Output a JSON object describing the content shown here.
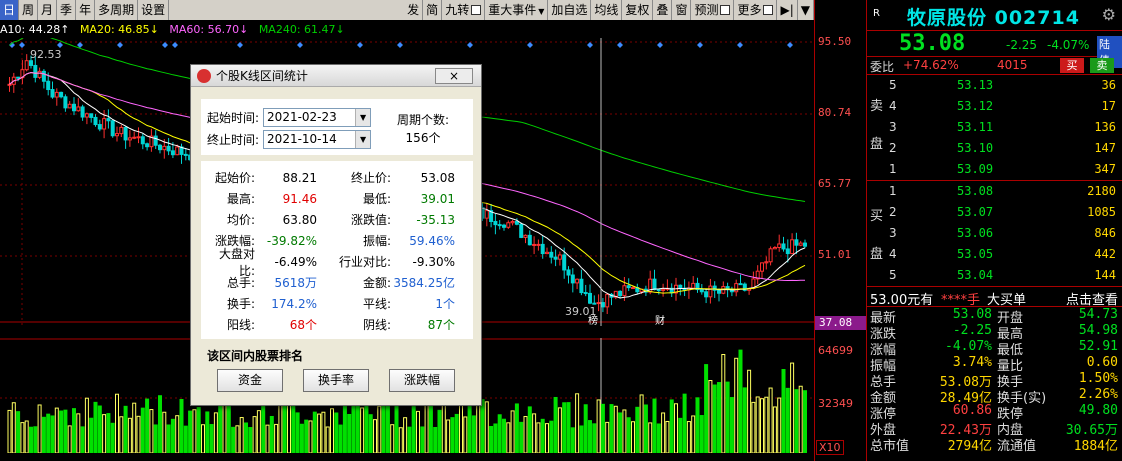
{
  "toolbar": {
    "left": [
      "日",
      "周",
      "月",
      "季",
      "年",
      "多周期",
      "设置"
    ],
    "right": [
      "发",
      "简",
      "九转",
      "重大事件",
      "加自选",
      "均线",
      "复权",
      "叠",
      "窗",
      "预测",
      "更多"
    ]
  },
  "ma": {
    "ma10": "A10: 44.28↑",
    "ma20": "MA20: 46.85↓",
    "ma60": "MA60: 56.70↓",
    "ma240": "MA240: 61.47↓",
    "colors": {
      "ma10": "#ffffff",
      "ma20": "#ffff00",
      "ma60": "#ff66ff",
      "ma240": "#00d000"
    }
  },
  "price_axis": [
    "95.50",
    "80.74",
    "65.77",
    "51.01",
    "37.08"
  ],
  "volume_axis": {
    "top": "64699",
    "mid": "32349",
    "unit": "X10"
  },
  "chart_marks": {
    "high_label": "92.53",
    "low_label": "39.01",
    "tag_1": "榜",
    "tag_2": "财"
  },
  "dialog": {
    "title": "个股K线区间统计",
    "close_label": "×",
    "start_label": "起始时间:",
    "start_value": "2021-02-23",
    "end_label": "终止时间:",
    "end_value": "2021-10-14",
    "period_label": "周期个数:",
    "period_value": "156个",
    "stats": [
      {
        "l1": "起始价:",
        "v1": "88.21",
        "c1": "",
        "l2": "终止价:",
        "v2": "53.08",
        "c2": ""
      },
      {
        "l1": "最高:",
        "v1": "91.46",
        "c1": "red",
        "l2": "最低:",
        "v2": "39.01",
        "c2": "green"
      },
      {
        "l1": "均价:",
        "v1": "63.80",
        "c1": "",
        "l2": "涨跌值:",
        "v2": "-35.13",
        "c2": "green"
      },
      {
        "l1": "涨跌幅:",
        "v1": "-39.82%",
        "c1": "green",
        "l2": "振幅:",
        "v2": "59.46%",
        "c2": "blue"
      },
      {
        "l1": "大盘对比:",
        "v1": "-6.49%",
        "c1": "",
        "l2": "行业对比:",
        "v2": "-9.30%",
        "c2": ""
      },
      {
        "l1": "总手:",
        "v1": "5618万",
        "c1": "blue",
        "l2": "金额:",
        "v2": "3584.25亿",
        "c2": "blue"
      },
      {
        "l1": "换手:",
        "v1": "174.2%",
        "c1": "blue",
        "l2": "平线:",
        "v2": "1个",
        "c2": "blue"
      },
      {
        "l1": "阳线:",
        "v1": "68个",
        "c1": "red",
        "l2": "阴线:",
        "v2": "87个",
        "c2": "green"
      }
    ],
    "rank_title": "该区间内股票排名",
    "rank_buttons": [
      "资金",
      "换手率",
      "涨跌幅"
    ]
  },
  "panel": {
    "badge": "R",
    "name": "牧原股份 002714",
    "price": "53.08",
    "change": "-2.25",
    "pct": "-4.07%",
    "tag": "陆债",
    "webi_label": "委比",
    "webi_value": "+74.62%",
    "webi_diff": "4015",
    "buy_btn": "买",
    "sell_btn": "卖",
    "sell_side": [
      "卖",
      "盘"
    ],
    "buy_side": [
      "买",
      "盘"
    ],
    "asks": [
      {
        "lvl": "5",
        "px": "53.13",
        "vol": "36"
      },
      {
        "lvl": "4",
        "px": "53.12",
        "vol": "17"
      },
      {
        "lvl": "3",
        "px": "53.11",
        "vol": "136"
      },
      {
        "lvl": "2",
        "px": "53.10",
        "vol": "147"
      },
      {
        "lvl": "1",
        "px": "53.09",
        "vol": "347"
      }
    ],
    "bids": [
      {
        "lvl": "1",
        "px": "53.08",
        "vol": "2180"
      },
      {
        "lvl": "2",
        "px": "53.07",
        "vol": "1085"
      },
      {
        "lvl": "3",
        "px": "53.06",
        "vol": "846"
      },
      {
        "lvl": "4",
        "px": "53.05",
        "vol": "442"
      },
      {
        "lvl": "5",
        "px": "53.04",
        "vol": "144"
      }
    ],
    "deal_text": "53.00元有",
    "deal_mask": "****手",
    "deal_big": "大买单",
    "deal_link": "点击查看",
    "info": [
      {
        "k1": "最新",
        "v1": "53.08",
        "c1": "c-green",
        "k2": "开盘",
        "v2": "54.73",
        "c2": "c-green"
      },
      {
        "k1": "涨跌",
        "v1": "-2.25",
        "c1": "c-green",
        "k2": "最高",
        "v2": "54.98",
        "c2": "c-green"
      },
      {
        "k1": "涨幅",
        "v1": "-4.07%",
        "c1": "c-green",
        "k2": "最低",
        "v2": "52.91",
        "c2": "c-green"
      },
      {
        "k1": "振幅",
        "v1": "3.74%",
        "c1": "c-yellow",
        "k2": "量比",
        "v2": "0.60",
        "c2": "c-yellow"
      },
      {
        "k1": "总手",
        "v1": "53.08万",
        "c1": "c-yellow",
        "k2": "换手",
        "v2": "1.50%",
        "c2": "c-yellow"
      },
      {
        "k1": "金额",
        "v1": "28.49亿",
        "c1": "c-yellow",
        "k2": "换手(实)",
        "v2": "2.26%",
        "c2": "c-yellow"
      },
      {
        "k1": "涨停",
        "v1": "60.86",
        "c1": "c-red",
        "k2": "跌停",
        "v2": "49.80",
        "c2": "c-green"
      },
      {
        "k1": "外盘",
        "v1": "22.43万",
        "c1": "c-red",
        "k2": "内盘",
        "v2": "30.65万",
        "c2": "c-green"
      },
      {
        "k1": "总市值",
        "v1": "2794亿",
        "c1": "c-yellow",
        "k2": "流通值",
        "v2": "1884亿",
        "c2": "c-yellow"
      }
    ]
  }
}
